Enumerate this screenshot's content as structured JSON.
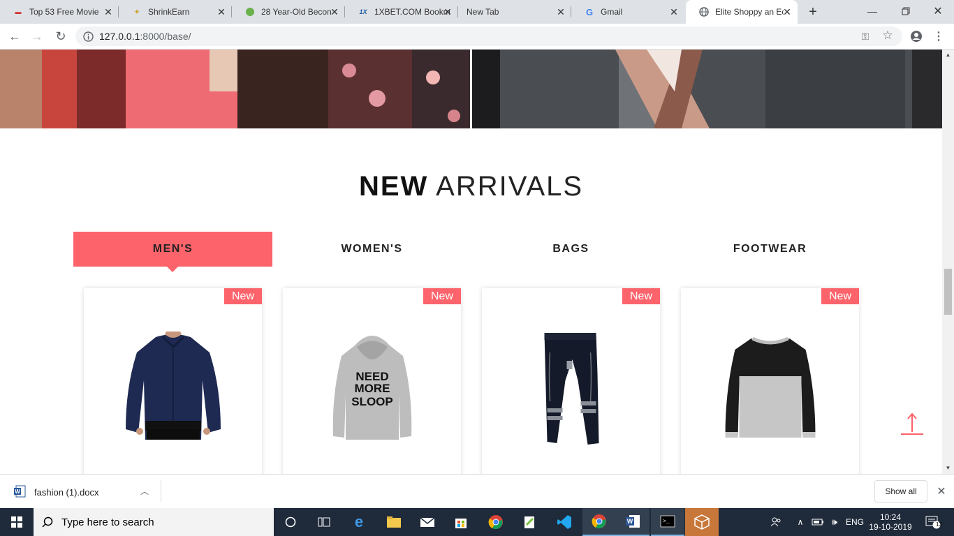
{
  "browser": {
    "tabs": [
      {
        "title": "Top 53 Free Movie",
        "favicon": "tdm-icon"
      },
      {
        "title": "ShrinkEarn",
        "favicon": "shrinkearn-icon"
      },
      {
        "title": "28 Year-Old Becon",
        "favicon": "leaf-icon"
      },
      {
        "title": "1XBET.COM Bookm",
        "favicon": "1xbet-icon",
        "favicon_text": "1X"
      },
      {
        "title": "New Tab",
        "favicon": ""
      },
      {
        "title": "Gmail",
        "favicon": "google-icon",
        "favicon_text": "G"
      },
      {
        "title": "Elite Shoppy an Ec",
        "favicon": "globe-icon"
      }
    ],
    "url_host": "127.0.0.1",
    "url_path": ":8000/base/"
  },
  "page": {
    "section_title_bold": "NEW",
    "section_title_light": "ARRIVALS",
    "categories": [
      {
        "label": "MEN'S",
        "active": true
      },
      {
        "label": "WOMEN'S",
        "active": false
      },
      {
        "label": "BAGS",
        "active": false
      },
      {
        "label": "FOOTWEAR",
        "active": false
      }
    ],
    "products": [
      {
        "badge": "New",
        "image": "navy-shirt"
      },
      {
        "badge": "New",
        "image": "grey-hoodie",
        "print_line1": "NEED",
        "print_line2": "MORE",
        "print_line3": "SLOOP"
      },
      {
        "badge": "New",
        "image": "track-pants"
      },
      {
        "badge": "New",
        "image": "raglan-tee"
      }
    ],
    "accent_color": "#fc636b"
  },
  "downloads": {
    "file_name": "fashion (1).docx",
    "show_all": "Show all"
  },
  "taskbar": {
    "search_placeholder": "Type here to search",
    "language": "ENG",
    "time": "10:24",
    "date": "19-10-2019",
    "notification_count": "13"
  }
}
